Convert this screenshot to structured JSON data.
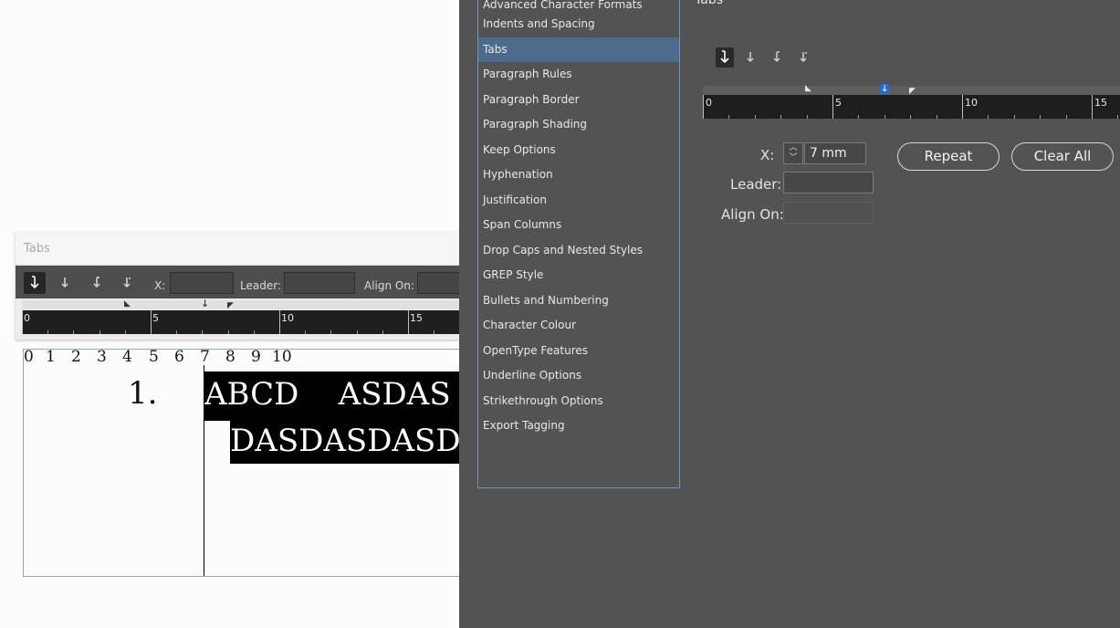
{
  "panel": {
    "title": "Tabs",
    "x_label": "X:",
    "leader_label": "Leader:",
    "align_label": "Align On:",
    "x_value": "",
    "leader_value": "",
    "align_value": "",
    "ruler_labels": [
      "0",
      "5",
      "10",
      "15"
    ]
  },
  "document": {
    "digit_ruler": [
      "0",
      "1",
      "2",
      "3",
      "4",
      "5",
      "6",
      "7",
      "8",
      "9",
      "10"
    ],
    "list_number": "1.",
    "line1": "ABCD    ASDAS",
    "line2": "DASDASDASD"
  },
  "dialog": {
    "title": "Tabs",
    "categories": [
      "Advanced Character Formats",
      "Indents and Spacing",
      "Tabs",
      "Paragraph Rules",
      "Paragraph Border",
      "Paragraph Shading",
      "Keep Options",
      "Hyphenation",
      "Justification",
      "Span Columns",
      "Drop Caps and Nested Styles",
      "GREP Style",
      "Bullets and Numbering",
      "Character Colour",
      "OpenType Features",
      "Underline Options",
      "Strikethrough Options",
      "Export Tagging"
    ],
    "selected_category": "Tabs",
    "ruler_labels": [
      "0",
      "5",
      "10",
      "15"
    ],
    "x_label": "X:",
    "x_value": "7 mm",
    "leader_label": "Leader:",
    "leader_value": "",
    "align_label": "Align On:",
    "align_value": "",
    "repeat_label": "Repeat",
    "clear_all_label": "Clear All"
  },
  "icons": {
    "left_tab": "↓",
    "center_tab": "↓",
    "right_tab": "↓",
    "decimal_tab": "↓"
  }
}
